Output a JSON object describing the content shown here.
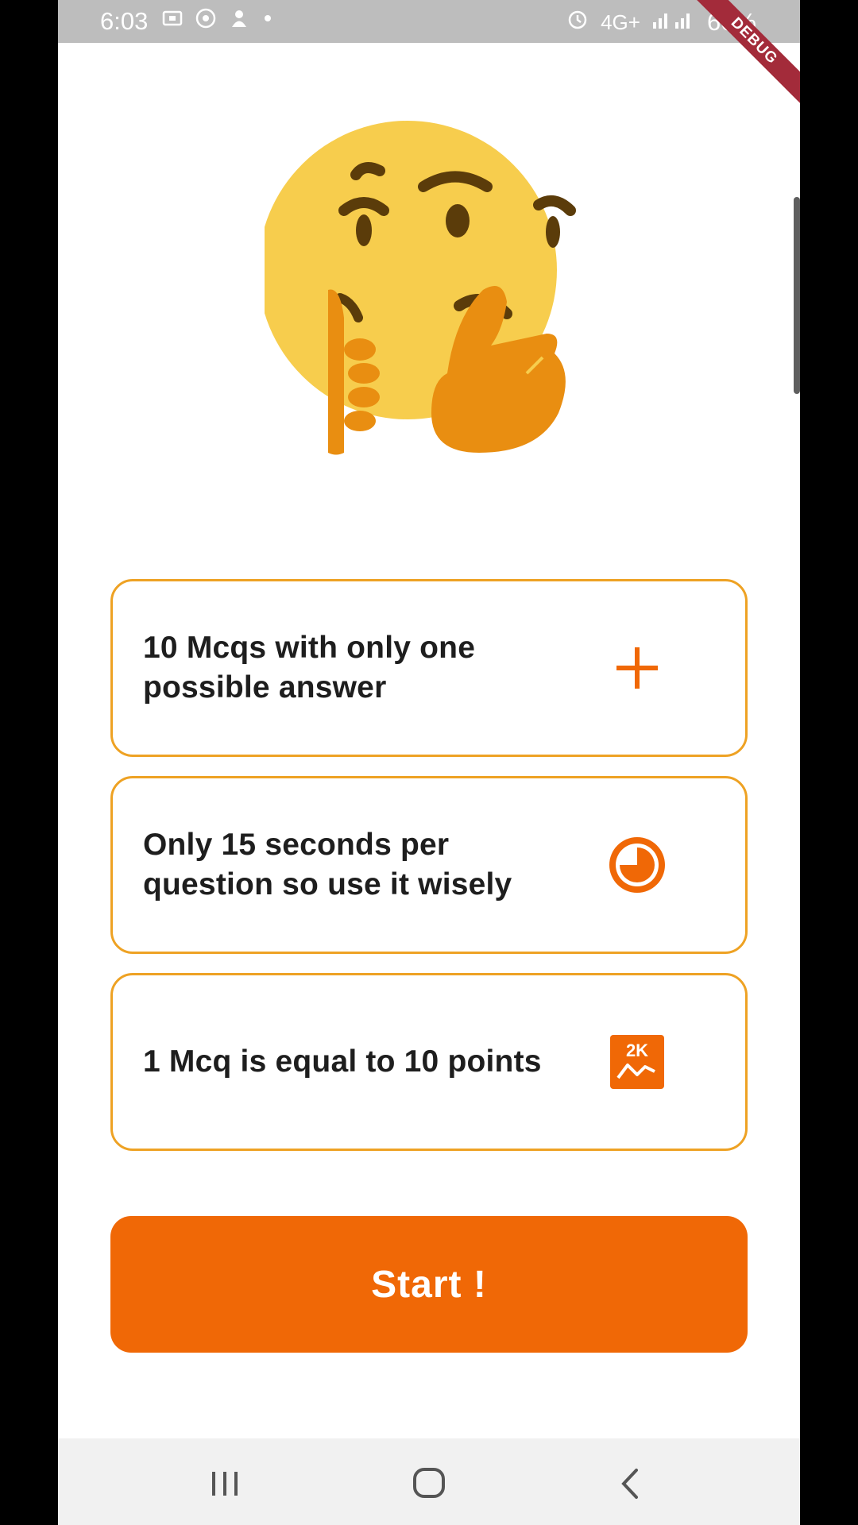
{
  "status_bar": {
    "time": "6:03",
    "battery": "60%",
    "network": "4G+",
    "icons": [
      "screenshot-icon",
      "wifi-hotspot-icon",
      "notification-icon",
      "dot-icon",
      "alarm-icon",
      "signal-icon",
      "battery-icon"
    ]
  },
  "debug_banner": "DEBUG",
  "illustration": {
    "icon": "thinking-face-emoji"
  },
  "rules": [
    {
      "text": "10 Mcqs with only one possible answer",
      "icon": "plus-icon"
    },
    {
      "text": "Only 15 seconds per question so use it wisely",
      "icon": "timer-icon"
    },
    {
      "text": "1 Mcq is equal to 10 points",
      "icon": "points-chart-icon",
      "icon_text": "2K"
    }
  ],
  "start_button": {
    "label": "Start !"
  },
  "colors": {
    "accent": "#f06806",
    "card_border": "#eea224",
    "emoji_face": "#f7cd4d",
    "emoji_hand": "#e98e11"
  },
  "nav": {
    "icons": [
      "recent-apps-icon",
      "home-icon",
      "back-icon"
    ]
  }
}
